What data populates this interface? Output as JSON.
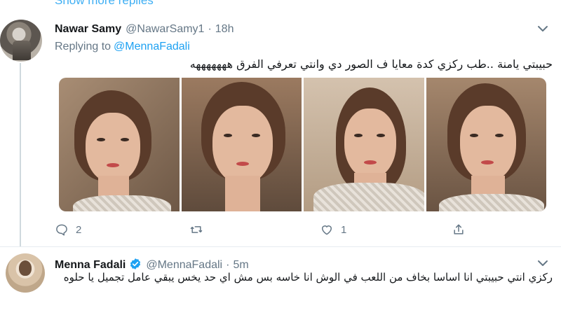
{
  "thread": {
    "show_more_label": "Show more replies"
  },
  "tweet1": {
    "name": "Nawar Samy",
    "handle": "@NawarSamy1",
    "separator": "·",
    "time": "18h",
    "replying_prefix": "Replying to",
    "replying_to": "@MennaFadali",
    "text": "حبيبتي يامنة ..طب ركزي كدة معايا ف الصور دي وانتي تعرفي الفرق هههههههه",
    "photos": [
      "photo-1",
      "photo-2",
      "photo-3",
      "photo-4"
    ],
    "actions": {
      "reply_count": "2",
      "retweet_count": "",
      "like_count": "1"
    }
  },
  "tweet2": {
    "name": "Menna Fadali",
    "verified": true,
    "handle": "@MennaFadali",
    "separator": "·",
    "time": "5m",
    "text": "ركزي انتي حبيبتي انا اساسا بخاف من اللعب في الوش انا خاسه بس مش اي حد يخس يبقي عامل تجميل يا حلوه"
  },
  "colors": {
    "accent": "#1da1f2",
    "muted": "#657786",
    "text": "#14171a",
    "divider": "#e6ecf0"
  },
  "icons": {
    "reply": "reply-bubble-icon",
    "retweet": "retweet-icon",
    "like": "heart-icon",
    "share": "share-icon",
    "more": "chevron-down-icon",
    "verified": "verified-badge-icon"
  }
}
